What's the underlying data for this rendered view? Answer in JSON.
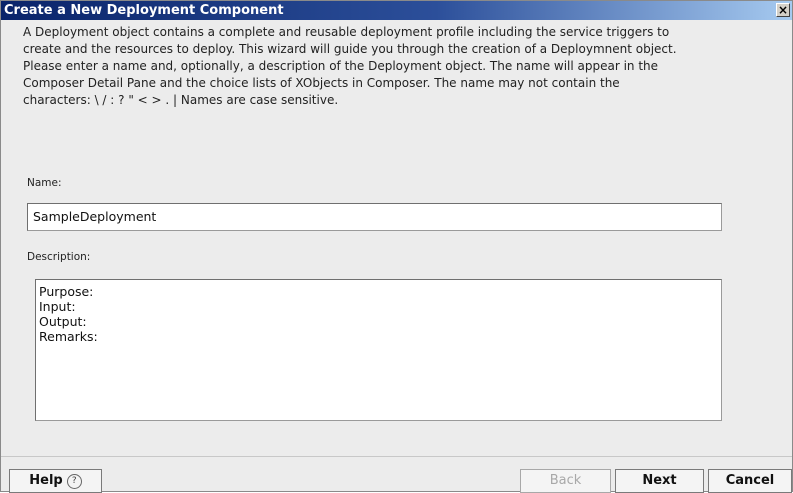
{
  "window": {
    "title": "Create a New Deployment Component",
    "close_glyph": "×"
  },
  "intro": {
    "lines": [
      "A Deployment object contains a complete and reusable deployment profile including the service triggers to",
      "create and the resources to deploy.  This wizard will guide you through the creation of a Deploymnent object.",
      "Please enter a name and, optionally, a description of the Deployment object.  The name will appear in the",
      "Composer Detail Pane and the choice lists of XObjects in Composer.  The name may not contain the",
      "characters: \\ / : ? \" < > . |  Names are case sensitive."
    ]
  },
  "form": {
    "name_label": "Name:",
    "name_value": "SampleDeployment",
    "description_label": "Description:",
    "description_lines": [
      "Purpose:",
      "Input:",
      "Output:",
      "Remarks:"
    ]
  },
  "buttons": {
    "help": "Help",
    "help_icon": "?",
    "back": "Back",
    "next": "Next",
    "cancel": "Cancel"
  }
}
